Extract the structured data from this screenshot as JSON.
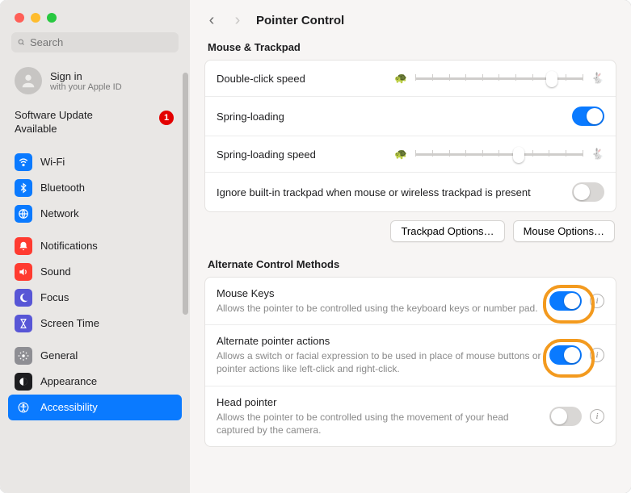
{
  "search": {
    "placeholder": "Search"
  },
  "signin": {
    "title": "Sign in",
    "subtitle": "with your Apple ID"
  },
  "update": {
    "text": "Software Update Available",
    "count": "1"
  },
  "sidebar": {
    "items": [
      {
        "label": "Wi-Fi"
      },
      {
        "label": "Bluetooth"
      },
      {
        "label": "Network"
      },
      {
        "label": "Notifications"
      },
      {
        "label": "Sound"
      },
      {
        "label": "Focus"
      },
      {
        "label": "Screen Time"
      },
      {
        "label": "General"
      },
      {
        "label": "Appearance"
      },
      {
        "label": "Accessibility"
      }
    ]
  },
  "page": {
    "title": "Pointer Control"
  },
  "section1": {
    "title": "Mouse & Trackpad",
    "doubleClick": "Double-click speed",
    "springLoading": "Spring-loading",
    "springSpeed": "Spring-loading speed",
    "ignoreTrackpad": "Ignore built-in trackpad when mouse or wireless trackpad is present",
    "trackpadBtn": "Trackpad Options…",
    "mouseBtn": "Mouse Options…"
  },
  "section2": {
    "title": "Alternate Control Methods",
    "mouseKeys": {
      "label": "Mouse Keys",
      "desc": "Allows the pointer to be controlled using the keyboard keys or number pad."
    },
    "altActions": {
      "label": "Alternate pointer actions",
      "desc": "Allows a switch or facial expression to be used in place of mouse buttons or pointer actions like left-click and right-click."
    },
    "headPointer": {
      "label": "Head pointer",
      "desc": "Allows the pointer to be controlled using the movement of your head captured by the camera."
    }
  }
}
